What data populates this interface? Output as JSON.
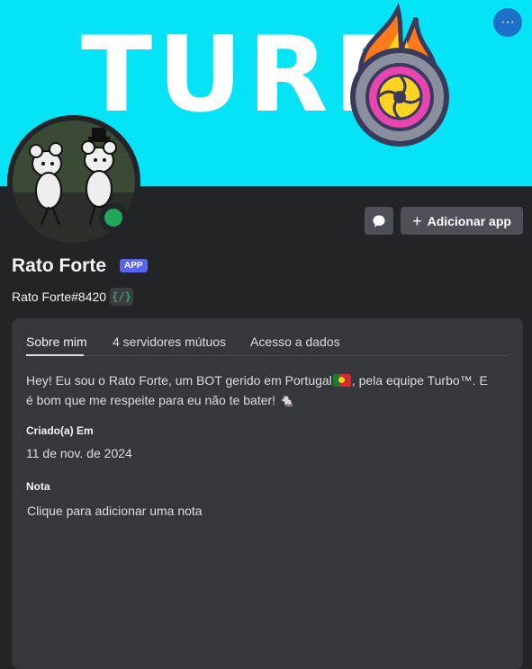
{
  "banner": {
    "word": "TURB",
    "bg_color": "#05e3f6",
    "logo_icon": "fire-wheel-logo"
  },
  "header": {
    "more_icon_glyph": "···"
  },
  "profile": {
    "display_name": "Rato Forte",
    "app_badge": "APP",
    "username": "Rato Forte#8420",
    "code_badge": "{/}",
    "status": "online",
    "status_color": "#23a55a"
  },
  "actions": {
    "message_icon": "chat-bubble-icon",
    "add_app_label": "Adicionar app",
    "add_app_icon": "+"
  },
  "tabs": [
    {
      "label": "Sobre mim",
      "active": true
    },
    {
      "label": "4 servidores mútuos",
      "active": false
    },
    {
      "label": "Acesso a dados",
      "active": false
    }
  ],
  "about": {
    "bio_part1": "Hey! Eu sou o Rato Forte, um BOT gerido em Portugal",
    "bio_part2": ", pela equipe Turbo™. E é bom que me respeite para eu não te bater! ",
    "bio_emoji": "🐁",
    "created_label": "Criado(a) Em",
    "created_value": "11 de nov. de 2024",
    "note_label": "Nota",
    "note_placeholder": "Clique para adicionar uma nota"
  }
}
